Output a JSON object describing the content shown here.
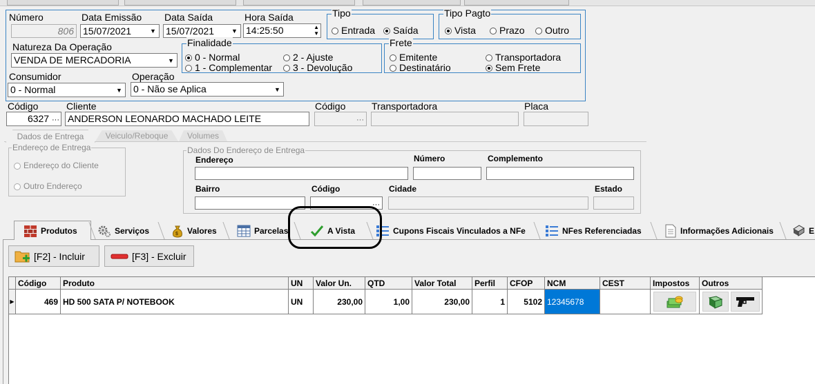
{
  "header": {
    "numero_label": "Número",
    "numero_value": "806",
    "emissao_label": "Data Emissão",
    "emissao_value": "15/07/2021",
    "saida_label": "Data Saída",
    "saida_value": "15/07/2021",
    "hora_label": "Hora Saída",
    "hora_value": "14:25:50",
    "tipo_title": "Tipo",
    "tipo_options": [
      "Entrada",
      "Saída"
    ],
    "tipo_selected": "Saída",
    "pagto_title": "Tipo Pagto",
    "pagto_options": [
      "Vista",
      "Prazo",
      "Outro"
    ],
    "pagto_selected": "Vista",
    "natureza_label": "Natureza Da Operação",
    "natureza_value": "VENDA DE MERCADORIA",
    "finalidade_title": "Finalidade",
    "finalidade_options": [
      "0 - Normal",
      "2 - Ajuste",
      "1 - Complementar",
      "3 - Devolução"
    ],
    "finalidade_selected": "0 - Normal",
    "frete_title": "Frete",
    "frete_options": [
      "Emitente",
      "Transportadora",
      "Destinatário",
      "Sem Frete"
    ],
    "frete_selected": "Sem Frete",
    "consumidor_label": "Consumidor",
    "consumidor_value": "0 - Normal",
    "operacao_label": "Operação",
    "operacao_value": "0 - Não se Aplica"
  },
  "cliente": {
    "codigo_label": "Código",
    "codigo_value": "6327",
    "cliente_label": "Cliente",
    "cliente_value": "ANDERSON LEONARDO MACHADO LEITE",
    "transp_codigo_label": "Código",
    "transportadora_label": "Transportadora",
    "placa_label": "Placa",
    "ellipsis": "···"
  },
  "entrega": {
    "tabs": [
      "Dados de Entrega",
      "Veiculo/Reboque",
      "Volumes"
    ],
    "endereco_title": "Endereço de Entrega",
    "endereco_options": [
      "Endereço do Cliente",
      "Outro Endereço"
    ],
    "dados_title": "Dados Do Endereço de Entrega",
    "fields": {
      "endereco": "Endereço",
      "numero": "Número",
      "complemento": "Complemento",
      "bairro": "Bairro",
      "codigo": "Código",
      "cidade": "Cidade",
      "estado": "Estado"
    }
  },
  "tabs": [
    {
      "label": "Produtos",
      "icon": "bricks-icon"
    },
    {
      "label": "Serviços",
      "icon": "gears-icon"
    },
    {
      "label": "Valores",
      "icon": "money-bag-icon"
    },
    {
      "label": "Parcelas",
      "icon": "table-icon"
    },
    {
      "label": "A Vista",
      "icon": "checkmark-icon"
    },
    {
      "label": "Cupons Fiscais Vinculados a NFe",
      "icon": "list-icon"
    },
    {
      "label": "NFes Referenciadas",
      "icon": "list-icon"
    },
    {
      "label": "Informações Adicionais",
      "icon": "document-icon"
    },
    {
      "label": "E",
      "icon": "book-icon"
    }
  ],
  "toolbar": {
    "incluir": "[F2] - Incluir",
    "excluir": "[F3] - Excluir"
  },
  "grid": {
    "columns": [
      "Código",
      "Produto",
      "UN",
      "Valor Un.",
      "QTD",
      "Valor Total",
      "Perfil",
      "CFOP",
      "NCM",
      "CEST",
      "Impostos",
      "Outros"
    ],
    "rows": [
      {
        "codigo": "469",
        "produto": "HD 500 SATA P/ NOTEBOOK",
        "un": "UN",
        "valor_un": "230,00",
        "qtd": "1,00",
        "valor_total": "230,00",
        "perfil": "1",
        "cfop": "5102",
        "ncm": "12345678",
        "cest": ""
      }
    ]
  },
  "colors": {
    "group_border": "#3a84c4",
    "highlight": "#0078d7",
    "annotation": "#000000"
  }
}
